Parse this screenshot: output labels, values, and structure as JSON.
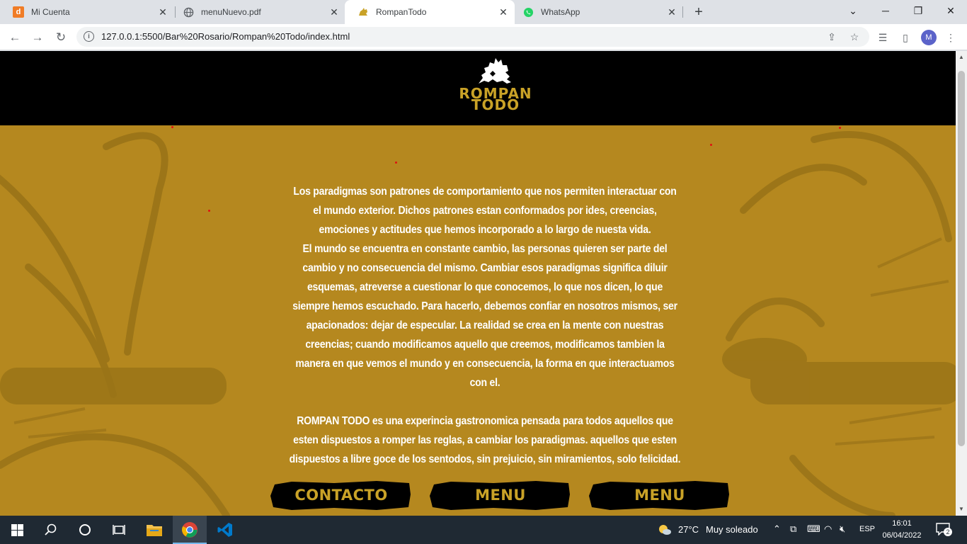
{
  "browser": {
    "tabs": [
      {
        "title": "Mi Cuenta",
        "favicon_letter": "d",
        "favicon_color": "#f07c26"
      },
      {
        "title": "menuNuevo.pdf",
        "favicon_icon": "globe-icon"
      },
      {
        "title": "RompanTodo",
        "favicon_icon": "rompan-logo-icon",
        "active": true
      },
      {
        "title": "WhatsApp",
        "favicon_icon": "whatsapp-icon",
        "favicon_color": "#25d366"
      }
    ],
    "url": "127.0.0.1:5500/Bar%20Rosario/Rompan%20Todo/index.html",
    "profile_initial": "M"
  },
  "site": {
    "brand_line1": "ROMPAN",
    "brand_line2": "TODO",
    "colors": {
      "gold": "#b5881f",
      "logo_gold": "#c9a227",
      "header_bg": "#000000"
    },
    "paragraphs": [
      "Los paradigmas son patrones de comportamiento que nos permiten interactuar con el mundo exterior. Dichos patrones estan conformados por ides, creencias, emociones y actitudes que hemos incorporado a lo largo de nuesta vida.",
      "El mundo se encuentra en constante cambio, las personas quieren ser parte del cambio y no consecuencia del mismo. Cambiar esos paradigmas significa diluir esquemas, atreverse a cuestionar lo que conocemos, lo que nos dicen, lo que siempre hemos escuchado. Para hacerlo, debemos confiar en nosotros mismos, ser apacionados: dejar de especular. La realidad se crea en la mente con nuestras creencias; cuando modificamos aquello que creemos, modificamos tambien la manera en que vemos el mundo y en consecuencia, la forma en que interactuamos con el.",
      "ROMPAN TODO es una experincia gastronomica pensada para todos aquellos que esten dispuestos a romper las reglas, a cambiar los paradigmas. aquellos que esten dispuestos a libre goce de los sentodos, sin prejuicio, sin miramientos, solo felicidad."
    ],
    "buttons": {
      "contact": "CONTACTO",
      "menu_1": "MENU",
      "menu_2": "MENU"
    }
  },
  "taskbar": {
    "weather_temp": "27°C",
    "weather_text": "Muy soleado",
    "language": "ESP",
    "time": "16:01",
    "date": "06/04/2022",
    "notifications": "2"
  }
}
